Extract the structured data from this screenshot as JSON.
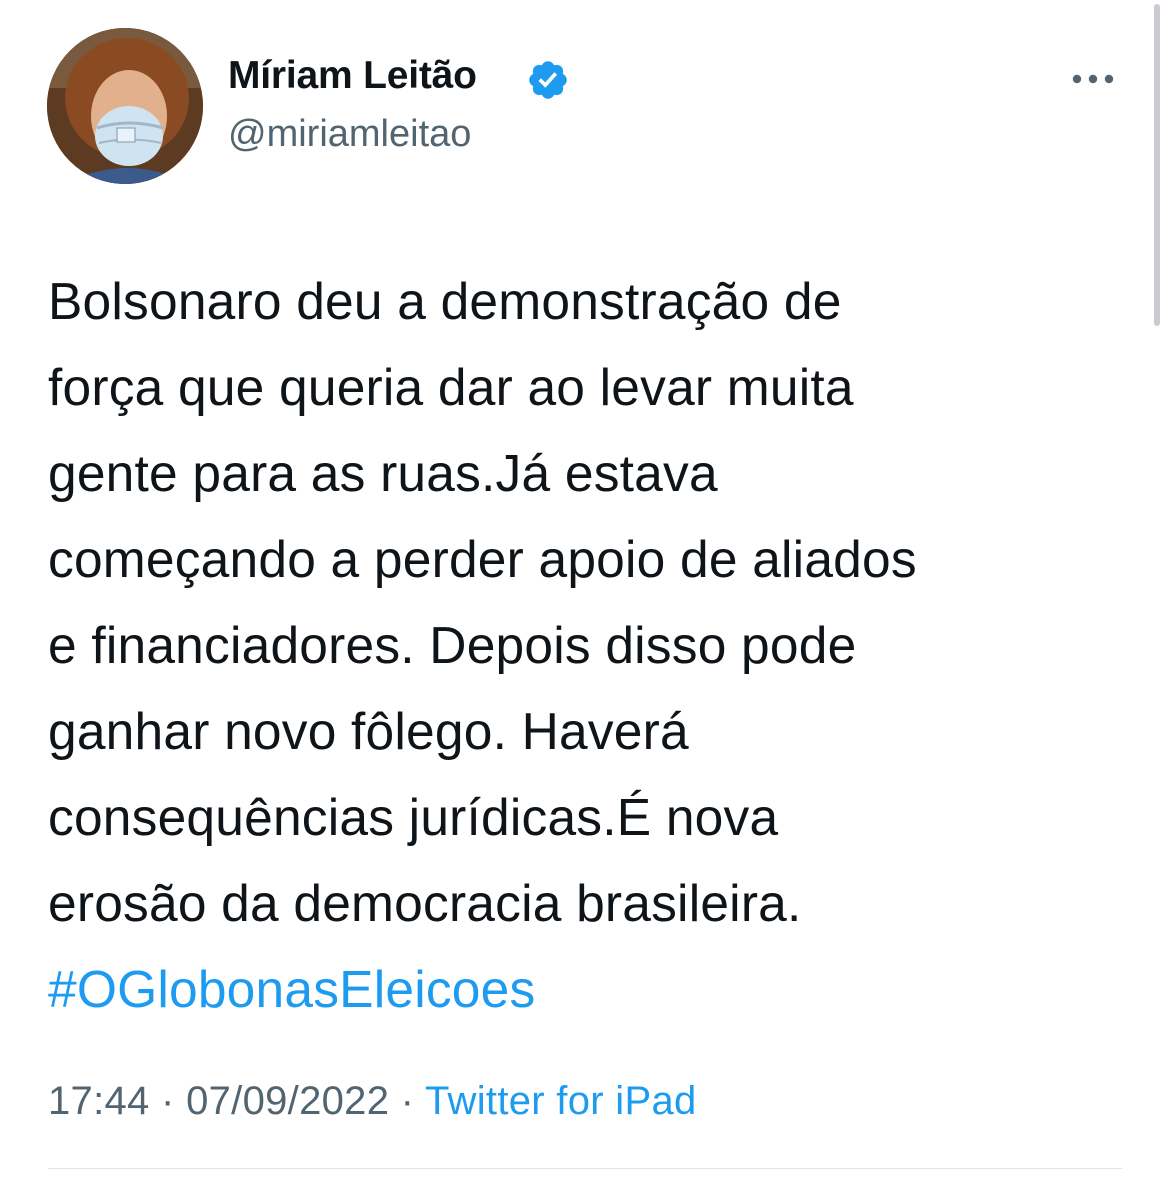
{
  "author": {
    "display_name": "Míriam Leitão",
    "handle": "@miriamleitao"
  },
  "tweet": {
    "lines": [
      "Bolsonaro deu a demonstração de",
      "força que queria dar ao levar muita",
      "gente para as ruas.Já estava",
      "começando a perder apoio de aliados",
      "e financiadores. Depois disso pode",
      "ganhar novo fôlego. Haverá",
      "consequências jurídicas.É nova",
      "erosão da democracia brasileira."
    ],
    "hashtag": "#OGlobonasEleicoes"
  },
  "meta": {
    "time": "17:44",
    "separator": " · ",
    "date": "07/09/2022",
    "source": "Twitter for iPad"
  },
  "icons": {
    "verified": "verified-badge-icon",
    "more": "more-options-icon"
  },
  "colors": {
    "link": "#1d9bf0",
    "secondary_text": "#536471",
    "primary_text": "#0f1419"
  }
}
